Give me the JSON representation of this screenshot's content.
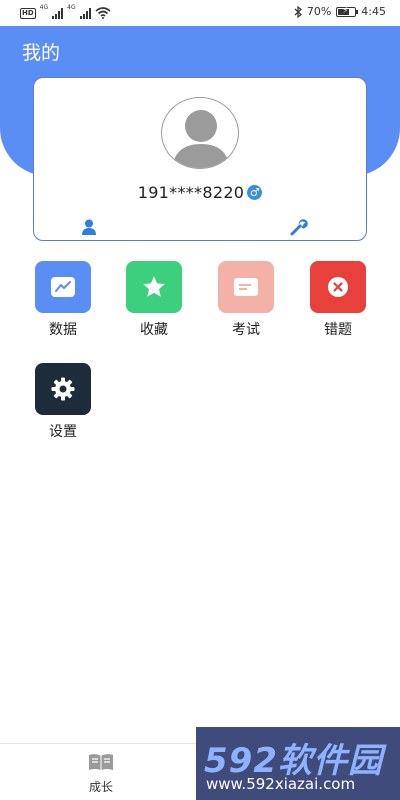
{
  "status_bar": {
    "hd": "HD",
    "net1": "4G",
    "net2": "4G",
    "battery_text": "70%",
    "battery_level": 0.7,
    "time": "4:45"
  },
  "header": {
    "title": "我的"
  },
  "profile": {
    "phone": "191****8220",
    "gender_symbol": "♂"
  },
  "menu": [
    {
      "label": "数据",
      "color": "#5b8ef5",
      "icon": "chart-icon"
    },
    {
      "label": "收藏",
      "color": "#3ccf7d",
      "icon": "star-icon"
    },
    {
      "label": "考试",
      "color": "#f3b1a8",
      "icon": "document-icon"
    },
    {
      "label": "错题",
      "color": "#e8413b",
      "icon": "close-circle-icon"
    },
    {
      "label": "设置",
      "color": "#1e2b3a",
      "icon": "gear-icon"
    }
  ],
  "bottom_nav": {
    "growth_label": "成长"
  },
  "watermark": {
    "brand": "592软件园",
    "url": "www.592xiazai.com"
  }
}
